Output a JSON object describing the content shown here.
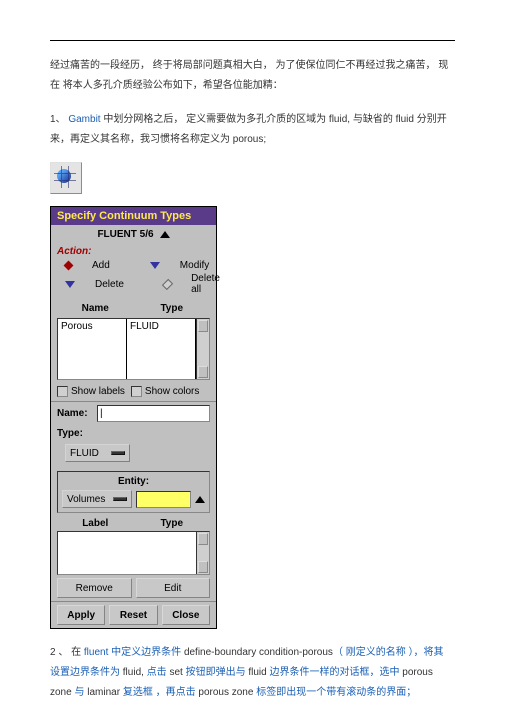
{
  "para1": "经过痛苦的一段经历， 终于将局部问题真相大白， 为了使保位同仁不再经过我之痛苦，  现在 将本人多孔介质经验公布如下，希望各位能加精：",
  "para2_pre": "1、 ",
  "para2_gambit": "Gambit ",
  "para2_mid1": "中划分网格之后，  定义需要做为多孔介质的区域为 ",
  "para2_fluid1": "fluid, ",
  "para2_mid2": "与缺省的 ",
  "para2_fluid2": "fluid ",
  "para2_mid3": "分别开 来，再定义其名称，我习惯将名称定义为 ",
  "para2_porous": "porous",
  "para2_end": ";",
  "panel": {
    "title": "Specify Continuum Types",
    "subbar": "FLUENT 5/6",
    "action_label": "Action:",
    "radios": {
      "add": "Add",
      "modify": "Modify",
      "delete": "Delete",
      "delete_all": "Delete all"
    },
    "headers": {
      "name": "Name",
      "type": "Type"
    },
    "list": {
      "name_val": "Porous",
      "type_val": "FLUID"
    },
    "show_labels": "Show labels",
    "show_colors": "Show colors",
    "name_lbl": "Name:",
    "name_val": "|",
    "type_lbl": "Type:",
    "type_btn": "FLUID",
    "entity_lbl": "Entity:",
    "entity_btn": "Volumes",
    "label_header": "Label",
    "type_header2": "Type",
    "btn_remove": "Remove",
    "btn_edit": "Edit",
    "btn_apply": "Apply",
    "btn_reset": "Reset",
    "btn_close": "Close"
  },
  "para3_pre": "2 、 在 ",
  "para3_fluent": "fluent ",
  "para3_t1": "中定义边界条件 ",
  "para3_dbc": "define-boundary condition-porous",
  "para3_t2": "（ 刚定义的名称 ）",
  "para3_t3": "，将其 设置边界条件为 ",
  "para3_fluid": "fluid, ",
  "para3_t4": "点击 ",
  "para3_set": "set ",
  "para3_t5": "按钮即弹出与 ",
  "para3_fluid2": "fluid ",
  "para3_t6": "边界条件一样的对话框，选中 ",
  "para3_pz": "porous zone ",
  "para3_t7": "与 ",
  "para3_lam": "laminar ",
  "para3_t8": "复选框 ，再点击 ",
  "para3_pz2": "porous zone ",
  "para3_t9": "标签即出现一个带有滚动条的界面；"
}
